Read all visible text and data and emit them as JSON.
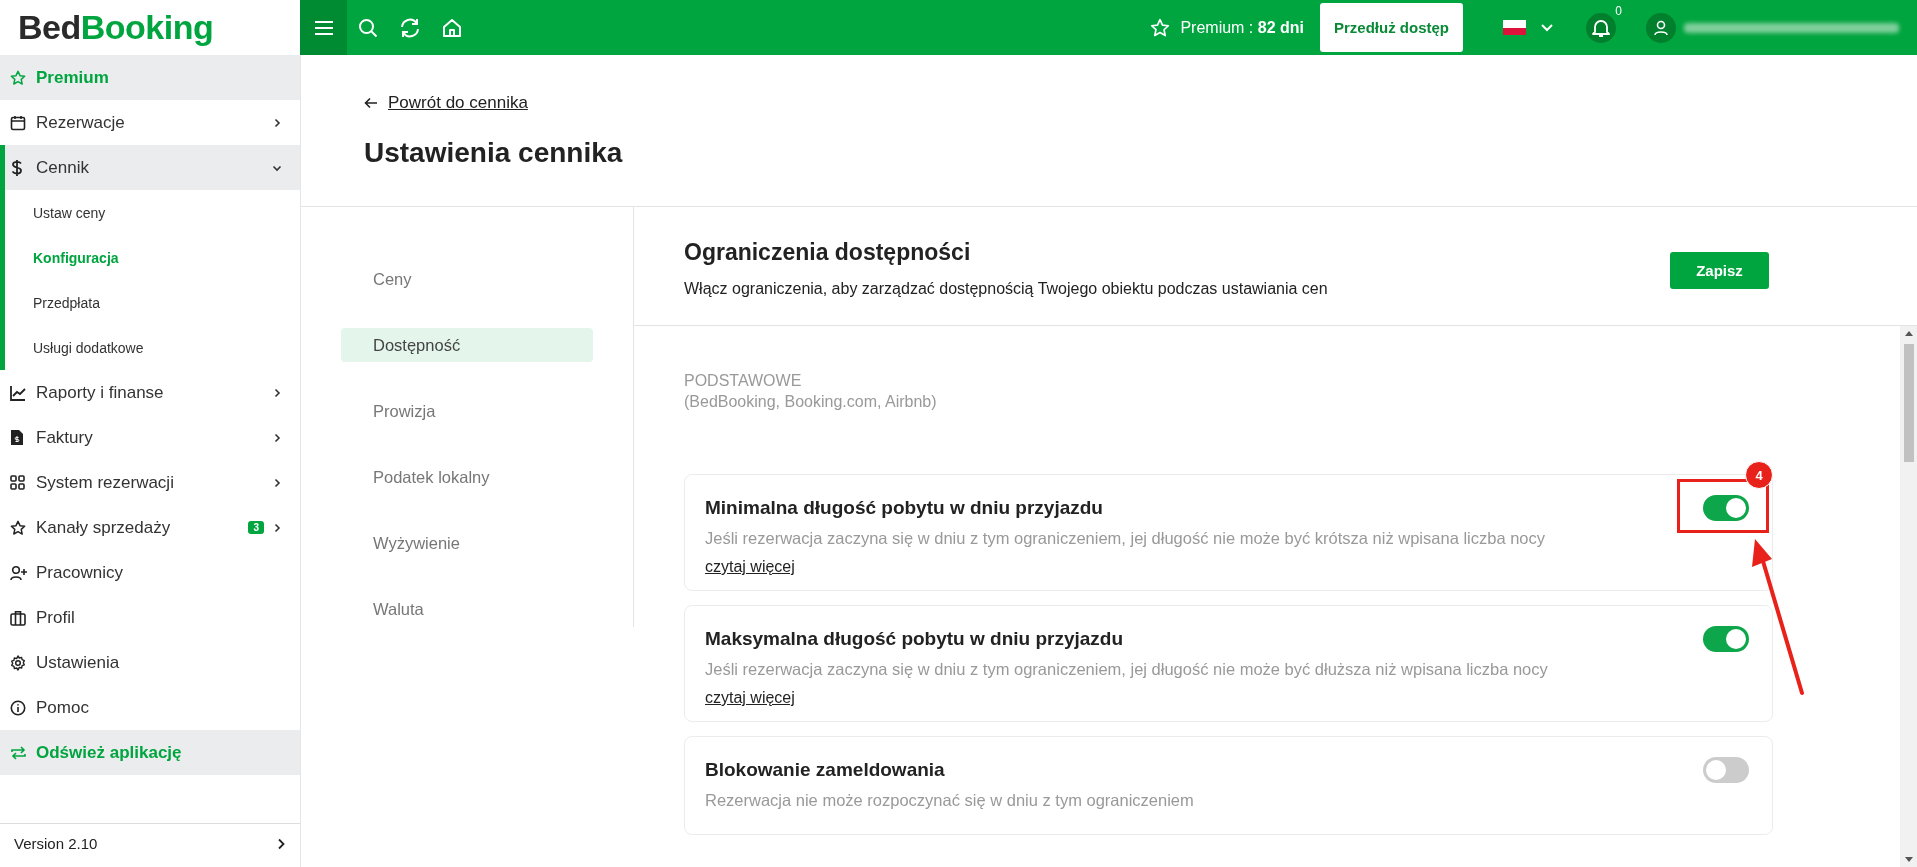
{
  "logo": {
    "first": "Bed",
    "second": "Booking"
  },
  "topbar": {
    "premium": "Premium : **82 dni**",
    "extend_button": "Przedłuż dostęp",
    "notifications_count": "0"
  },
  "sidebar": {
    "items": [
      {
        "label": "Premium",
        "kind": "highlight"
      },
      {
        "label": "Rezerwacje",
        "kind": "menu",
        "expanded": false
      },
      {
        "label": "Cennik",
        "kind": "menu",
        "expanded": true,
        "children": [
          {
            "label": "Ustaw ceny",
            "selected": false
          },
          {
            "label": "Konfiguracja",
            "selected": true
          },
          {
            "label": "Przedpłata",
            "selected": false
          },
          {
            "label": "Usługi dodatkowe",
            "selected": false
          }
        ]
      },
      {
        "label": "Raporty i finanse",
        "kind": "menu",
        "expanded": false
      },
      {
        "label": "Faktury",
        "kind": "menu",
        "expanded": false
      },
      {
        "label": "System rezerwacji",
        "kind": "menu",
        "expanded": false
      },
      {
        "label": "Kanały sprzedaży",
        "kind": "menu",
        "expanded": false,
        "badge": "3"
      },
      {
        "label": "Pracownicy",
        "kind": "menu"
      },
      {
        "label": "Profil",
        "kind": "menu"
      },
      {
        "label": "Ustawienia",
        "kind": "menu"
      },
      {
        "label": "Pomoc",
        "kind": "menu"
      },
      {
        "label": "Odśwież aplikację",
        "kind": "highlight"
      }
    ],
    "version": "Version 2.10"
  },
  "page": {
    "back_link": "Powrót do cennika",
    "title": "Ustawienia cennika"
  },
  "tabs": [
    {
      "label": "Ceny",
      "selected": false
    },
    {
      "label": "Dostępność",
      "selected": true
    },
    {
      "label": "Prowizja",
      "selected": false
    },
    {
      "label": "Podatek lokalny",
      "selected": false
    },
    {
      "label": "Wyżywienie",
      "selected": false
    },
    {
      "label": "Waluta",
      "selected": false
    }
  ],
  "section": {
    "title": "Ograniczenia dostępności",
    "description": "Włącz ograniczenia, aby zarządzać dostępnością Twojego obiektu podczas ustawiania cen",
    "save_button": "Zapisz",
    "group_label": "PODSTAWOWE",
    "group_sublabel": "(BedBooking, Booking.com, Airbnb)"
  },
  "restrictions": [
    {
      "title": "Minimalna długość pobytu w dniu przyjazdu",
      "description": "Jeśli rezerwacja zaczyna się w dniu z tym ograniczeniem, jej długość nie może być krótsza niż wpisana liczba nocy",
      "link": "czytaj więcej",
      "on": true,
      "annotation": {
        "badge": "4"
      }
    },
    {
      "title": "Maksymalna długość pobytu w dniu przyjazdu",
      "description": "Jeśli rezerwacja zaczyna się w dniu z tym ograniczeniem, jej długość nie może być dłuższa niż wpisana liczba nocy",
      "link": "czytaj więcej",
      "on": true
    },
    {
      "title": "Blokowanie zameldowania",
      "description": "Rezerwacja nie może rozpoczynać się w dniu z tym ograniczeniem",
      "on": false
    }
  ]
}
